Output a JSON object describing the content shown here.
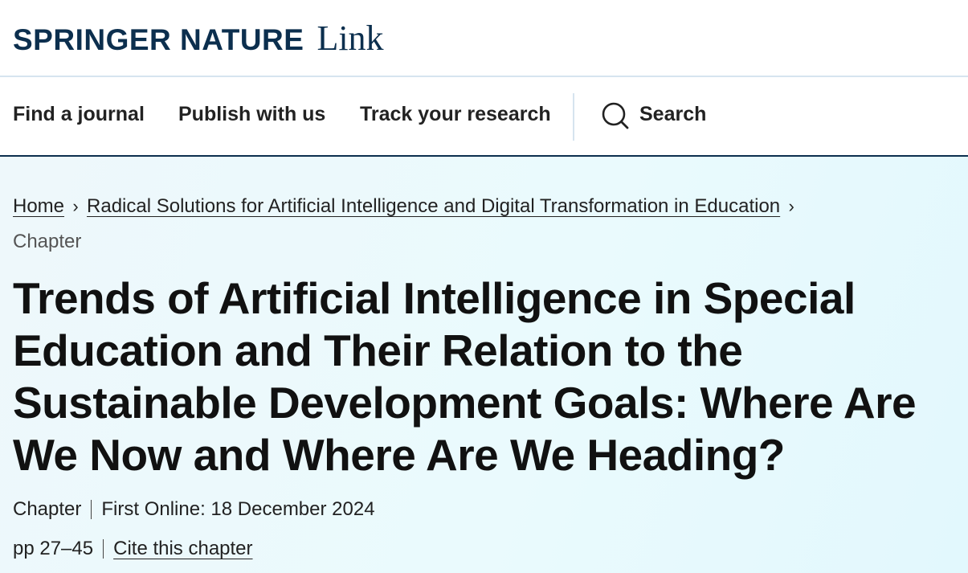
{
  "header": {
    "brand": "SPRINGER NATURE",
    "product": "Link"
  },
  "nav": {
    "items": [
      "Find a journal",
      "Publish with us",
      "Track your research"
    ],
    "search_label": "Search",
    "search_icon": "search-icon"
  },
  "breadcrumb": {
    "home": "Home",
    "book": "Radical Solutions for Artificial Intelligence and Digital Transformation in Education",
    "current": "Chapter"
  },
  "article": {
    "title": "Trends of Artificial Intelligence in Special Education and Their Relation to the Sustainable Development Goals: Where Are We Now and Where Are We Heading?",
    "type": "Chapter",
    "first_online": "First Online: 18 December 2024",
    "pages": "pp 27–45",
    "cite_label": "Cite this chapter"
  },
  "colors": {
    "brand": "#0c2f4e",
    "text": "#222222",
    "hero_background": "#eaf9fc"
  }
}
